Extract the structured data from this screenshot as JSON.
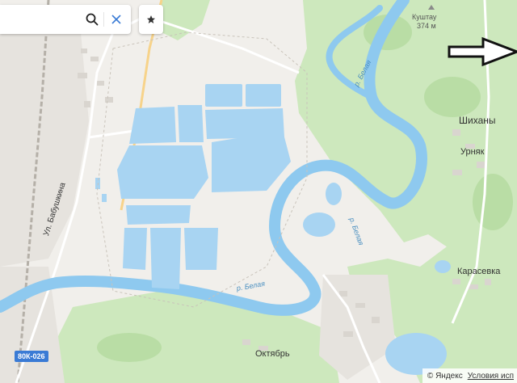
{
  "search": {
    "value": "",
    "placeholder": ""
  },
  "icons": {
    "search": "search-icon",
    "clear": "close-icon",
    "bookmark": "star-icon",
    "arrow": "arrow-right-icon",
    "peak": "peak-triangle-icon"
  },
  "labels": {
    "peak_name": "Куштау",
    "peak_height": "374 м",
    "shikhany": "Шиханы",
    "urnyak": "Урняк",
    "karasevka": "Карасевка",
    "oktyabr": "Октябрь",
    "street": "Ул. Бабушкина",
    "river_top": "р. Белая",
    "river_mid": "р. Белая",
    "river_low": "р. Белая",
    "road": "80К-026"
  },
  "footer": {
    "brand": "© Яндекс",
    "terms": "Условия исп"
  },
  "colors": {
    "land": "#f1efeb",
    "forest": "#cde8bd",
    "water": "#a8d4f2",
    "river": "#8ec9ef",
    "road": "#ffffff",
    "road_major": "#f7d38a",
    "urban": "#e6e3de"
  }
}
